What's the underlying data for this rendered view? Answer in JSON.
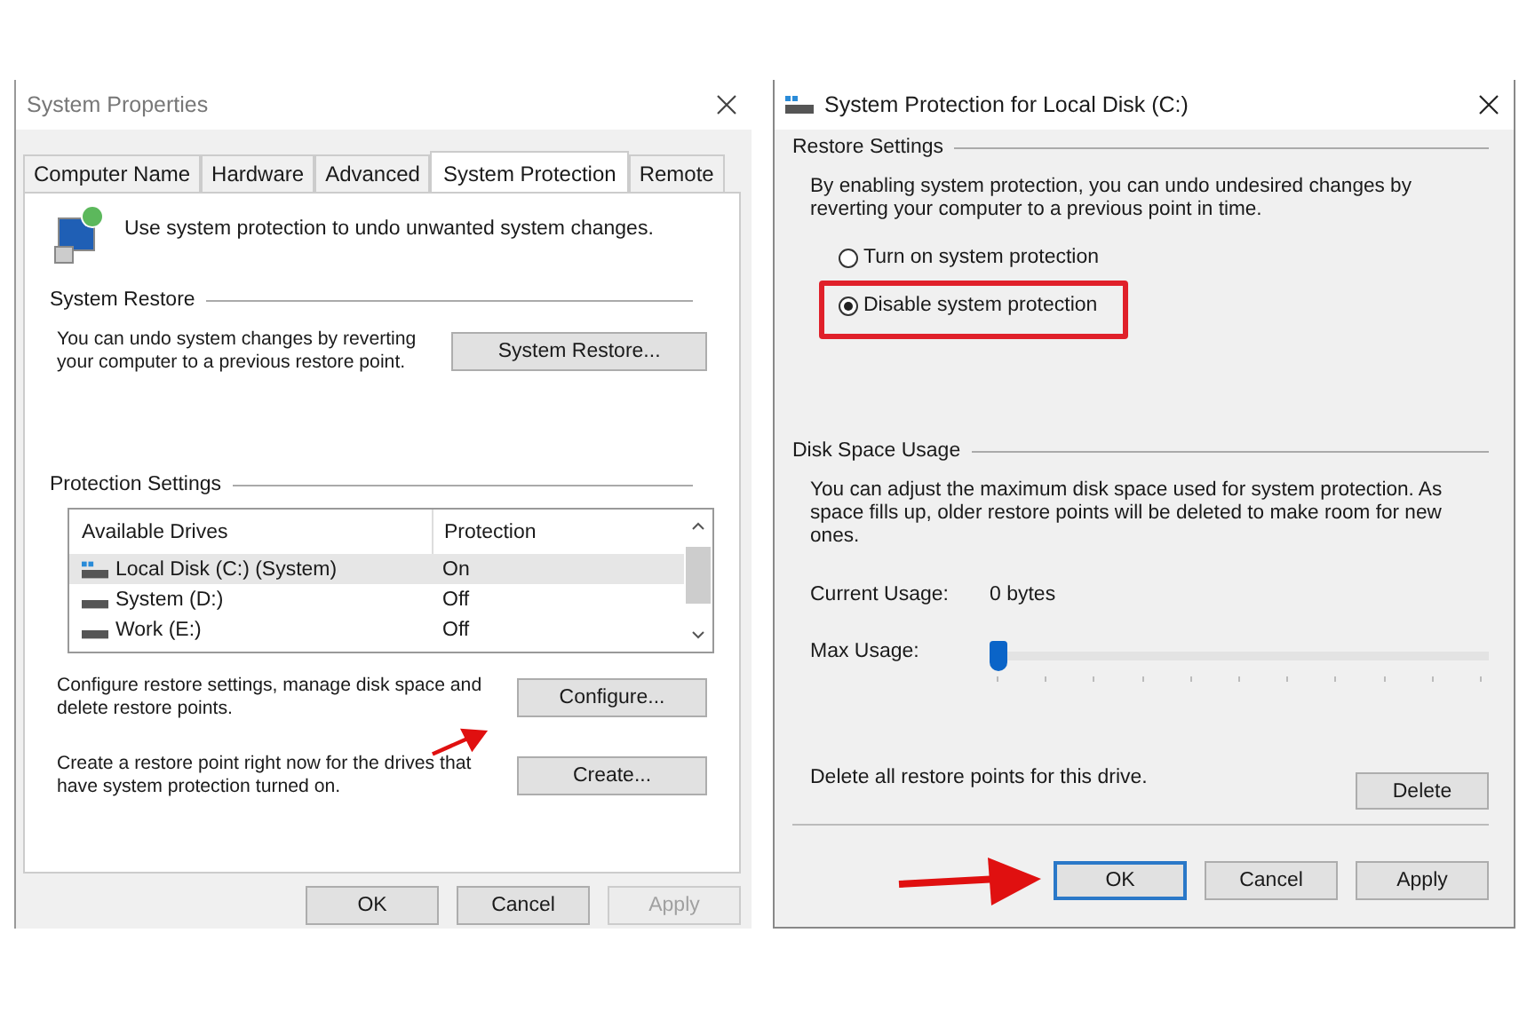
{
  "system_properties": {
    "title": "System Properties",
    "tabs": [
      {
        "label": "Computer Name",
        "selected": false
      },
      {
        "label": "Hardware",
        "selected": false
      },
      {
        "label": "Advanced",
        "selected": false
      },
      {
        "label": "System Protection",
        "selected": true
      },
      {
        "label": "Remote",
        "selected": false
      }
    ],
    "intro": "Use system protection to undo unwanted system changes.",
    "system_restore": {
      "heading": "System Restore",
      "text": "You can undo system changes by reverting your computer to a previous restore point.",
      "button": "System Restore..."
    },
    "protection_settings": {
      "heading": "Protection Settings",
      "columns": [
        "Available Drives",
        "Protection"
      ],
      "drives": [
        {
          "name": "Local Disk (C:) (System)",
          "protection": "On",
          "kind": "system",
          "selected": true
        },
        {
          "name": "System (D:)",
          "protection": "Off",
          "kind": "plain",
          "selected": false
        },
        {
          "name": "Work (E:)",
          "protection": "Off",
          "kind": "plain",
          "selected": false
        }
      ],
      "configure_text": "Configure restore settings, manage disk space and delete restore points.",
      "configure_button": "Configure...",
      "create_text": "Create a restore point right now for the drives that have system protection turned on.",
      "create_button": "Create..."
    },
    "buttons": [
      {
        "label": "OK",
        "disabled": false
      },
      {
        "label": "Cancel",
        "disabled": false
      },
      {
        "label": "Apply",
        "disabled": true
      }
    ]
  },
  "local_disk_dialog": {
    "title": "System Protection for Local Disk (C:)",
    "restore_settings": {
      "heading": "Restore Settings",
      "text": "By enabling system protection, you can undo undesired changes by reverting your computer to a previous point in time.",
      "options": [
        {
          "label": "Turn on system protection",
          "selected": false,
          "highlighted": false
        },
        {
          "label": "Disable system protection",
          "selected": true,
          "highlighted": true
        }
      ]
    },
    "disk_space": {
      "heading": "Disk Space Usage",
      "text": "You can adjust the maximum disk space used for system protection. As space fills up, older restore points will be deleted to make room for new ones.",
      "current_label": "Current Usage:",
      "current_value": "0 bytes",
      "max_label": "Max Usage:",
      "level": 0.0,
      "delete_text": "Delete all restore points for this drive.",
      "delete_button": "Delete"
    },
    "buttons": [
      {
        "label": "OK",
        "default": true
      },
      {
        "label": "Cancel",
        "default": false
      },
      {
        "label": "Apply",
        "default": false
      }
    ]
  }
}
